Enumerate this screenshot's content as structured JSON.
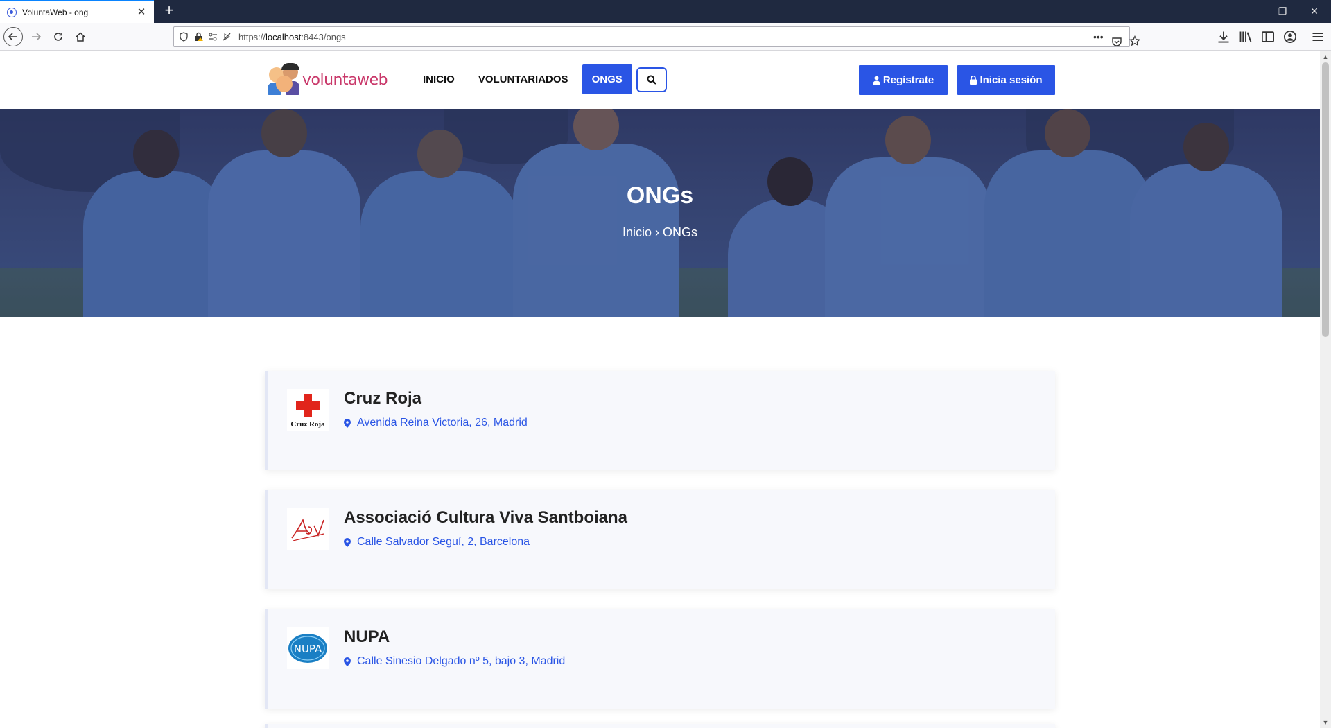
{
  "browser": {
    "tab_title": "VoluntaWeb - ong",
    "tab_close": "✕",
    "new_tab": "+",
    "url_prefix": "https://",
    "url_host": "localhost",
    "url_rest": ":8443/ongs",
    "page_actions": "•••",
    "window_controls": {
      "minimize": "—",
      "restore": "❐",
      "close": "✕"
    }
  },
  "site": {
    "logo_text": "voluntaweb",
    "menu": [
      {
        "label": "INICIO",
        "active": false
      },
      {
        "label": "VOLUNTARIADOS",
        "active": false
      },
      {
        "label": "ONGS",
        "active": true
      }
    ],
    "register_label": "Regístrate",
    "login_label": "Inicia sesión"
  },
  "hero": {
    "title": "ONGs",
    "breadcrumb": "Inicio › ONGs"
  },
  "ongs": [
    {
      "name": "Cruz Roja",
      "address": "Avenida Reina Victoria, 26, Madrid",
      "logo_caption": "Cruz Roja"
    },
    {
      "name": "Associació Cultura Viva Santboiana",
      "address": "Calle Salvador Seguí, 2, Barcelona",
      "logo_caption": "ACV"
    },
    {
      "name": "NUPA",
      "address": "Calle Sinesio Delgado nº 5, bajo 3, Madrid",
      "logo_caption": "NUPA"
    }
  ],
  "colors": {
    "accent": "#2a55e5",
    "browser_dark": "#1f2940",
    "hero_overlay": "#2f3b6a",
    "red_cross": "#e1251b",
    "nupa_blue": "#1a7fc4"
  }
}
